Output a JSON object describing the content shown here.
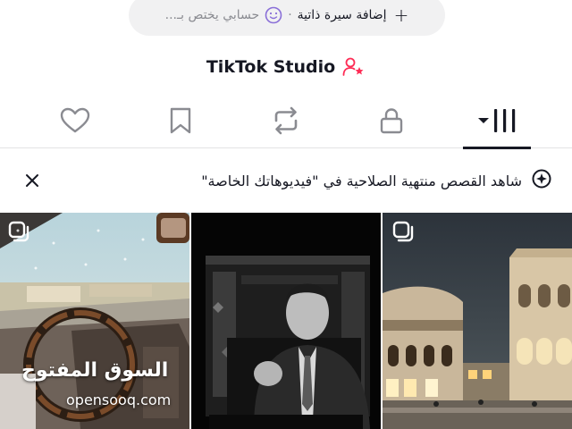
{
  "bio_bar": {
    "add_bio_label": "إضافة سيرة ذاتية",
    "separator": "·",
    "account_placeholder": "حسابي يختص بـ..."
  },
  "studio": {
    "label": "TikTok Studio",
    "icon": "person-star-icon"
  },
  "tabs": [
    {
      "name": "liked",
      "icon": "heart-icon",
      "active": false
    },
    {
      "name": "favorites",
      "icon": "bookmark-icon",
      "active": false
    },
    {
      "name": "reposts",
      "icon": "repost-icon",
      "active": false
    },
    {
      "name": "private",
      "icon": "lock-icon",
      "active": false
    },
    {
      "name": "videos",
      "icon": "grid-icon",
      "active": true
    }
  ],
  "banner": {
    "text": "شاهد القصص منتهية الصلاحية في \"فيديوهاتك الخاصة\"",
    "icon": "story-add-icon"
  },
  "videos": [
    {
      "name": "car-rain-video",
      "multi_icon": true
    },
    {
      "name": "tv-speaker-video",
      "multi_icon": false
    },
    {
      "name": "night-souq-video",
      "multi_icon": true
    }
  ],
  "watermark": {
    "arabic": "السوق المفتوح",
    "latin": "opensooq.com"
  },
  "colors": {
    "text": "#161823",
    "muted": "#8a8b91",
    "pill_bg": "#f1f1f2",
    "accent_pink": "#fe2c55",
    "divider": "#e3e3e4"
  }
}
